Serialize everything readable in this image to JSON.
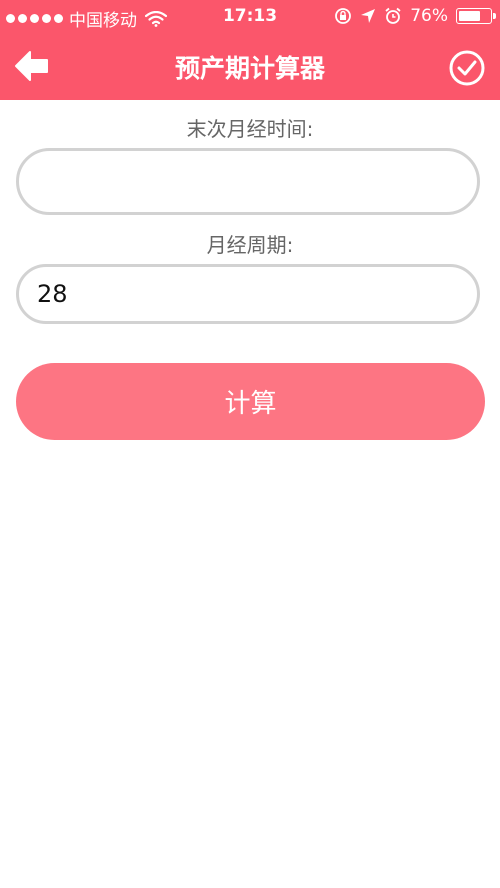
{
  "status_bar": {
    "carrier": "中国移动",
    "time": "17:13",
    "battery_percent": "76%",
    "battery_level": 0.76
  },
  "nav": {
    "title": "预产期计算器",
    "back_icon": "arrow-left-icon",
    "confirm_icon": "check-circle-icon"
  },
  "form": {
    "last_period_label": "末次月经时间:",
    "last_period_value": "",
    "cycle_label": "月经周期:",
    "cycle_value": "28"
  },
  "calculate_label": "计算",
  "colors": {
    "brand": "#fb566b",
    "button": "#fd7583",
    "input_border": "#d2d2d2",
    "label_text": "#666666"
  }
}
